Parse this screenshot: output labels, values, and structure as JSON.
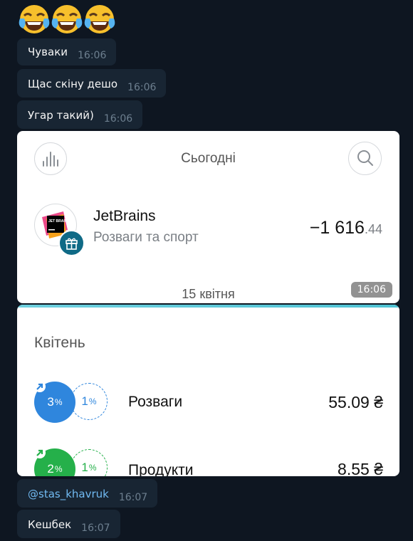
{
  "emojis": [
    "face-with-tears-of-joy",
    "face-with-tears-of-joy",
    "face-with-tears-of-joy"
  ],
  "messages": [
    {
      "text": "Чуваки",
      "time": "16:06"
    },
    {
      "text": "Щас скіну дешо",
      "time": "16:06"
    },
    {
      "text": "Угар такий)",
      "time": "16:06"
    }
  ],
  "image1": {
    "title": "Сьогодні",
    "merchant": "JetBrains",
    "category": "Розваги та спорт",
    "amount_main": "−1 616",
    "amount_cents": ".44",
    "date": "15 квітня",
    "time": "16:06",
    "logo_text": "JET BRAINS"
  },
  "image2": {
    "month": "Квітень",
    "rows": [
      {
        "pct": "3",
        "pct_small": "1",
        "name": "Розваги",
        "amount": "55.09 ₴",
        "color": "#2f86dd"
      },
      {
        "pct": "2",
        "pct_small": "1",
        "name": "Продукти",
        "amount": "8.55 ₴",
        "color": "#25b04a"
      }
    ],
    "percent_sign": "%"
  },
  "messages_after": [
    {
      "text": "@stas_khavruk",
      "time": "16:07"
    },
    {
      "text": "Кешбек",
      "time": "16:07"
    }
  ]
}
